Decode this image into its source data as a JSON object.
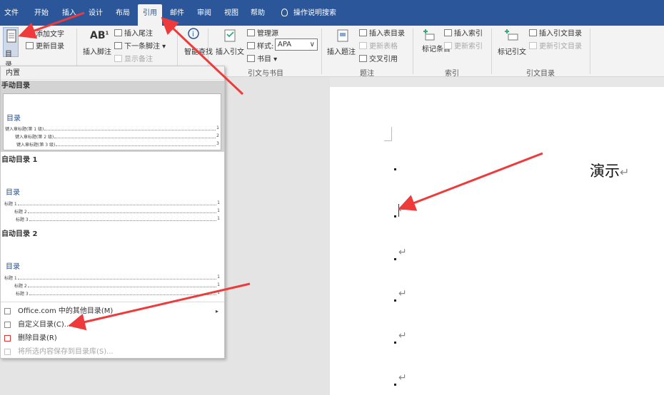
{
  "tabs": [
    "文件",
    "开始",
    "插入",
    "设计",
    "布局",
    "引用",
    "邮件",
    "审阅",
    "视图",
    "帮助"
  ],
  "active_tab": "引用",
  "tell_me": "操作说明搜索",
  "ribbon": {
    "toc": {
      "button_label": "目录",
      "add_text": "添加文字",
      "update_toc": "更新目录"
    },
    "footnotes": {
      "insert_footnote": "插入脚注",
      "insert_endnote": "插入尾注",
      "next_footnote": "下一条脚注",
      "show_notes": "显示备注"
    },
    "research": {
      "smart_lookup": "智能查找"
    },
    "citations": {
      "insert_citation": "插入引文",
      "manage_sources": "管理源",
      "style_label": "样式:",
      "style_value": "APA",
      "bibliography": "书目",
      "group_label": "引文与书目"
    },
    "captions": {
      "insert_caption": "插入题注",
      "insert_table_of_figures": "插入表目录",
      "update_table": "更新表格",
      "cross_reference": "交叉引用",
      "group_label": "题注"
    },
    "index": {
      "mark_entry": "标记条目",
      "insert_index": "插入索引",
      "update_index": "更新索引",
      "group_label": "索引"
    },
    "toa": {
      "mark_citation": "标记引文",
      "insert_toa": "插入引文目录",
      "update_toa": "更新引文目录",
      "group_label": "引文目录"
    }
  },
  "dropdown": {
    "section_header": "内置",
    "manual_toc": {
      "title": "手动目录",
      "heading": "目录",
      "rows": [
        {
          "text": "键入章标题(第 1 级)",
          "page": "1"
        },
        {
          "text": "键入章标题(第 2 级)",
          "page": "2"
        },
        {
          "text": "键入章标题(第 3 级)",
          "page": "3"
        }
      ]
    },
    "auto_toc_1": {
      "title": "自动目录 1",
      "heading": "目录",
      "rows": [
        {
          "text": "标题 1",
          "page": "1"
        },
        {
          "text": "标题 2",
          "page": "1"
        },
        {
          "text": "标题 3",
          "page": "1"
        }
      ]
    },
    "auto_toc_2": {
      "title": "自动目录 2",
      "heading": "目录",
      "rows": [
        {
          "text": "标题 1",
          "page": "1"
        },
        {
          "text": "标题 2",
          "page": "1"
        },
        {
          "text": "标题 3",
          "page": "1"
        }
      ]
    },
    "menu": {
      "more_from_office": "Office.com 中的其他目录(M)",
      "custom_toc": "自定义目录(C)...",
      "remove_toc": "删除目录(R)",
      "save_selection": "将所选内容保存到目录库(S)..."
    }
  },
  "document": {
    "title_text": "演示",
    "return_mark": "↵"
  },
  "colors": {
    "ribbon_blue": "#2b579a",
    "arrow_red": "#ee3a3a"
  }
}
